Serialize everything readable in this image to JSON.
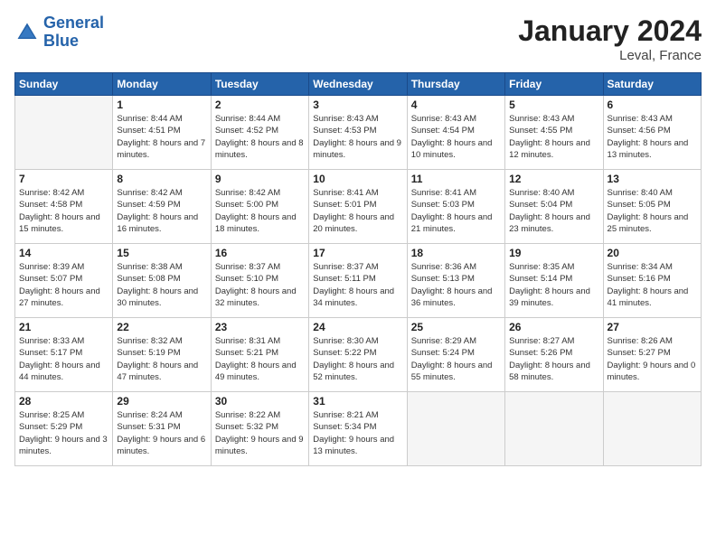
{
  "header": {
    "logo_line1": "General",
    "logo_line2": "Blue",
    "month_title": "January 2024",
    "location": "Leval, France"
  },
  "days_of_week": [
    "Sunday",
    "Monday",
    "Tuesday",
    "Wednesday",
    "Thursday",
    "Friday",
    "Saturday"
  ],
  "weeks": [
    [
      {
        "day": "",
        "empty": true
      },
      {
        "day": "1",
        "sunrise": "Sunrise: 8:44 AM",
        "sunset": "Sunset: 4:51 PM",
        "daylight": "Daylight: 8 hours and 7 minutes."
      },
      {
        "day": "2",
        "sunrise": "Sunrise: 8:44 AM",
        "sunset": "Sunset: 4:52 PM",
        "daylight": "Daylight: 8 hours and 8 minutes."
      },
      {
        "day": "3",
        "sunrise": "Sunrise: 8:43 AM",
        "sunset": "Sunset: 4:53 PM",
        "daylight": "Daylight: 8 hours and 9 minutes."
      },
      {
        "day": "4",
        "sunrise": "Sunrise: 8:43 AM",
        "sunset": "Sunset: 4:54 PM",
        "daylight": "Daylight: 8 hours and 10 minutes."
      },
      {
        "day": "5",
        "sunrise": "Sunrise: 8:43 AM",
        "sunset": "Sunset: 4:55 PM",
        "daylight": "Daylight: 8 hours and 12 minutes."
      },
      {
        "day": "6",
        "sunrise": "Sunrise: 8:43 AM",
        "sunset": "Sunset: 4:56 PM",
        "daylight": "Daylight: 8 hours and 13 minutes."
      }
    ],
    [
      {
        "day": "7",
        "sunrise": "Sunrise: 8:42 AM",
        "sunset": "Sunset: 4:58 PM",
        "daylight": "Daylight: 8 hours and 15 minutes."
      },
      {
        "day": "8",
        "sunrise": "Sunrise: 8:42 AM",
        "sunset": "Sunset: 4:59 PM",
        "daylight": "Daylight: 8 hours and 16 minutes."
      },
      {
        "day": "9",
        "sunrise": "Sunrise: 8:42 AM",
        "sunset": "Sunset: 5:00 PM",
        "daylight": "Daylight: 8 hours and 18 minutes."
      },
      {
        "day": "10",
        "sunrise": "Sunrise: 8:41 AM",
        "sunset": "Sunset: 5:01 PM",
        "daylight": "Daylight: 8 hours and 20 minutes."
      },
      {
        "day": "11",
        "sunrise": "Sunrise: 8:41 AM",
        "sunset": "Sunset: 5:03 PM",
        "daylight": "Daylight: 8 hours and 21 minutes."
      },
      {
        "day": "12",
        "sunrise": "Sunrise: 8:40 AM",
        "sunset": "Sunset: 5:04 PM",
        "daylight": "Daylight: 8 hours and 23 minutes."
      },
      {
        "day": "13",
        "sunrise": "Sunrise: 8:40 AM",
        "sunset": "Sunset: 5:05 PM",
        "daylight": "Daylight: 8 hours and 25 minutes."
      }
    ],
    [
      {
        "day": "14",
        "sunrise": "Sunrise: 8:39 AM",
        "sunset": "Sunset: 5:07 PM",
        "daylight": "Daylight: 8 hours and 27 minutes."
      },
      {
        "day": "15",
        "sunrise": "Sunrise: 8:38 AM",
        "sunset": "Sunset: 5:08 PM",
        "daylight": "Daylight: 8 hours and 30 minutes."
      },
      {
        "day": "16",
        "sunrise": "Sunrise: 8:37 AM",
        "sunset": "Sunset: 5:10 PM",
        "daylight": "Daylight: 8 hours and 32 minutes."
      },
      {
        "day": "17",
        "sunrise": "Sunrise: 8:37 AM",
        "sunset": "Sunset: 5:11 PM",
        "daylight": "Daylight: 8 hours and 34 minutes."
      },
      {
        "day": "18",
        "sunrise": "Sunrise: 8:36 AM",
        "sunset": "Sunset: 5:13 PM",
        "daylight": "Daylight: 8 hours and 36 minutes."
      },
      {
        "day": "19",
        "sunrise": "Sunrise: 8:35 AM",
        "sunset": "Sunset: 5:14 PM",
        "daylight": "Daylight: 8 hours and 39 minutes."
      },
      {
        "day": "20",
        "sunrise": "Sunrise: 8:34 AM",
        "sunset": "Sunset: 5:16 PM",
        "daylight": "Daylight: 8 hours and 41 minutes."
      }
    ],
    [
      {
        "day": "21",
        "sunrise": "Sunrise: 8:33 AM",
        "sunset": "Sunset: 5:17 PM",
        "daylight": "Daylight: 8 hours and 44 minutes."
      },
      {
        "day": "22",
        "sunrise": "Sunrise: 8:32 AM",
        "sunset": "Sunset: 5:19 PM",
        "daylight": "Daylight: 8 hours and 47 minutes."
      },
      {
        "day": "23",
        "sunrise": "Sunrise: 8:31 AM",
        "sunset": "Sunset: 5:21 PM",
        "daylight": "Daylight: 8 hours and 49 minutes."
      },
      {
        "day": "24",
        "sunrise": "Sunrise: 8:30 AM",
        "sunset": "Sunset: 5:22 PM",
        "daylight": "Daylight: 8 hours and 52 minutes."
      },
      {
        "day": "25",
        "sunrise": "Sunrise: 8:29 AM",
        "sunset": "Sunset: 5:24 PM",
        "daylight": "Daylight: 8 hours and 55 minutes."
      },
      {
        "day": "26",
        "sunrise": "Sunrise: 8:27 AM",
        "sunset": "Sunset: 5:26 PM",
        "daylight": "Daylight: 8 hours and 58 minutes."
      },
      {
        "day": "27",
        "sunrise": "Sunrise: 8:26 AM",
        "sunset": "Sunset: 5:27 PM",
        "daylight": "Daylight: 9 hours and 0 minutes."
      }
    ],
    [
      {
        "day": "28",
        "sunrise": "Sunrise: 8:25 AM",
        "sunset": "Sunset: 5:29 PM",
        "daylight": "Daylight: 9 hours and 3 minutes."
      },
      {
        "day": "29",
        "sunrise": "Sunrise: 8:24 AM",
        "sunset": "Sunset: 5:31 PM",
        "daylight": "Daylight: 9 hours and 6 minutes."
      },
      {
        "day": "30",
        "sunrise": "Sunrise: 8:22 AM",
        "sunset": "Sunset: 5:32 PM",
        "daylight": "Daylight: 9 hours and 9 minutes."
      },
      {
        "day": "31",
        "sunrise": "Sunrise: 8:21 AM",
        "sunset": "Sunset: 5:34 PM",
        "daylight": "Daylight: 9 hours and 13 minutes."
      },
      {
        "day": "",
        "empty": true
      },
      {
        "day": "",
        "empty": true
      },
      {
        "day": "",
        "empty": true
      }
    ]
  ]
}
